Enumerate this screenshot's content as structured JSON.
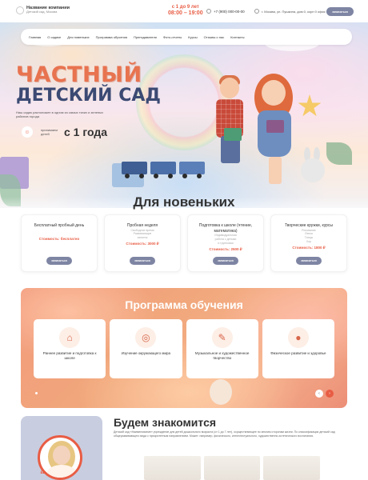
{
  "header": {
    "company_name": "Название компании",
    "company_sub": "Детский сад, Москва",
    "ages": "с 1 до 9 лет",
    "hours": "08:00 – 19:00",
    "phone": "+7 (900) 000-00-00",
    "address": "г. Москва, ул. Пушкина, дом 0, корп 0 офис 0",
    "cta_label": "записаться"
  },
  "nav": {
    "items": [
      "Главная",
      "О садике",
      "Для новеньких",
      "Программа обучения",
      "Преподаватели",
      "Фото-отчеты",
      "Курсы",
      "Отзывы о нас",
      "Контакты"
    ]
  },
  "hero": {
    "title_line1": "ЧАСТНЫЙ",
    "title_line2": "ДЕТСКИЙ САД",
    "description": "Наш садик расположен в одном из самых тихих и зеленых районов города",
    "badge_label_1": "принимаем",
    "badge_label_2": "детей",
    "age_from": "с 1 года"
  },
  "newcomers": {
    "title": "Для новеньких",
    "cards": [
      {
        "title": "Бесплатный пробный день",
        "lines": [],
        "price": "Стоимость: бесплатно",
        "button": "записаться"
      },
      {
        "title": "Пробная неделя",
        "lines": [
          "Свободное время",
          "Развивающие",
          "занятия"
        ],
        "price": "Стоимость: 3000 ₽",
        "button": "записаться"
      },
      {
        "title": "Подготовка к школе (чтение, математика)",
        "lines": [
          "Индивидуальная",
          "работа с детьми",
          "и групповая"
        ],
        "price": "Стоимость: 2500 ₽",
        "button": "записаться"
      },
      {
        "title": "Творческие кружки, курсы",
        "lines": [
          "Рисование",
          "Лепка",
          "Танцы",
          "Хор"
        ],
        "price": "Стоимость: 1800 ₽",
        "button": "записаться"
      }
    ]
  },
  "program": {
    "title": "Программа обучения",
    "cards": [
      {
        "title": "Раннее развитие и подготовка к школе",
        "icon": "house-icon"
      },
      {
        "title": "Изучение окружающего мира",
        "icon": "globe-icon"
      },
      {
        "title": "Музыкальное и художественное творчество",
        "icon": "palette-icon"
      },
      {
        "title": "Физическое развитие и здоровье",
        "icon": "ball-icon"
      }
    ],
    "prev_label": "‹",
    "next_label": "›"
  },
  "about": {
    "title": "Будем знакомится",
    "text": "Детский сад «Наименование» учреждение для детей дошкольного возраста (от 1 до 7 лет), осуществляющее по многим сторонам жизни. По классификации детский сад общеразвивающего вида с приоритетным направлением. Может: например, физического, интеллектуального, художественно-эстетического воспитания.",
    "quote_mark": "“"
  },
  "colors": {
    "accent": "#e85d44",
    "button": "#7e85a3",
    "navy": "#3b4a73"
  }
}
